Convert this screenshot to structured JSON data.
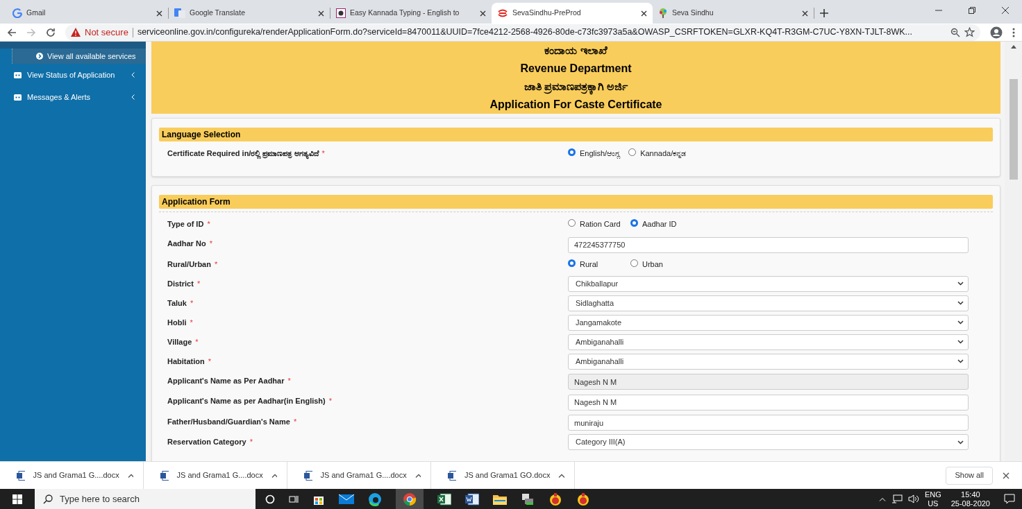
{
  "browser": {
    "tabs": [
      {
        "label": "Gmail",
        "selected": false,
        "kind": "gmail"
      },
      {
        "label": "Google Translate",
        "selected": false,
        "kind": "translate"
      },
      {
        "label": "Easy Kannada Typing - English to",
        "selected": false,
        "kind": "kannada"
      },
      {
        "label": "SevaSindhu-PreProd",
        "selected": true,
        "kind": "seva"
      },
      {
        "label": "Seva Sindhu",
        "selected": false,
        "kind": "tree"
      }
    ],
    "security": "Not secure",
    "url": "serviceonline.gov.in/configureka/renderApplicationForm.do?serviceId=8470011&UUID=7fce4212-2568-4926-80de-c73fc3973a5a&OWASP_CSRFTOKEN=GLXR-KQ4T-R3GM-C7UC-Y8XN-TJLT-8WK..."
  },
  "sidebar": {
    "items": [
      {
        "label": "View all available services",
        "kind": "sub",
        "selected": true
      },
      {
        "label": "View Status of Application",
        "kind": "menu",
        "selected": false
      },
      {
        "label": "Messages & Alerts",
        "kind": "menu",
        "selected": false
      }
    ]
  },
  "header": {
    "lines": [
      "ಕಂದಾಯ ಇಲಾಖೆ",
      "Revenue Department",
      "ಜಾತಿ ಪ್ರಮಾಣಪತ್ರಕ್ಕಾಗಿ ಅರ್ಜಿ",
      "Application For Caste Certificate"
    ]
  },
  "sections": [
    {
      "title": "Language Selection",
      "fields": [
        {
          "label": "Certificate Required in/ರಲ್ಲಿ ಪ್ರಮಾಣಪತ್ರ ಅಗತ್ಯವಿದೆ",
          "required": "*",
          "kind": "radio",
          "options": [
            {
              "label": "English/ಆಂಗ್ಲ",
              "selected": true
            },
            {
              "label": "Kannada/ಕನ್ನಡ",
              "selected": false
            }
          ]
        }
      ]
    },
    {
      "title": "Application Form",
      "fields": [
        {
          "label": "Type of ID",
          "required": "*",
          "kind": "radio",
          "options": [
            {
              "label": "Ration Card",
              "selected": false
            },
            {
              "label": "Aadhar ID",
              "selected": true
            }
          ]
        },
        {
          "label": "Aadhar No",
          "required": "*",
          "kind": "text",
          "value": "472245377750",
          "disabled": false
        },
        {
          "label": "Rural/Urban",
          "required": "*",
          "kind": "radio",
          "options": [
            {
              "label": "Rural",
              "selected": true
            },
            {
              "label": "Urban",
              "selected": false
            }
          ]
        },
        {
          "label": "District",
          "required": "*",
          "kind": "select",
          "value": "Chikballapur"
        },
        {
          "label": "Taluk",
          "required": "*",
          "kind": "select",
          "value": "Sidlaghatta"
        },
        {
          "label": "Hobli",
          "required": "*",
          "kind": "select",
          "value": "Jangamakote"
        },
        {
          "label": "Village",
          "required": "*",
          "kind": "select",
          "value": "Ambiganahalli"
        },
        {
          "label": "Habitation",
          "required": "*",
          "kind": "select",
          "value": "Ambiganahalli"
        },
        {
          "label": "Applicant's Name as Per Aadhar",
          "required": "*",
          "kind": "text",
          "value": "Nagesh N M",
          "disabled": true
        },
        {
          "label": "Applicant's Name as per Aadhar(in English)",
          "required": "*",
          "kind": "text",
          "value": "Nagesh N M",
          "disabled": false
        },
        {
          "label": "Father/Husband/Guardian's Name",
          "required": "*",
          "kind": "text",
          "value": "muniraju",
          "disabled": false
        },
        {
          "label": "Reservation Category",
          "required": "*",
          "kind": "select",
          "value": "Category III(A)"
        }
      ]
    }
  ],
  "downloads": {
    "items": [
      "JS and Grama1 G....docx",
      "JS and Grama1 G....docx",
      "JS and Grama1 G....docx",
      "JS and Grama1 GO.docx"
    ],
    "show_all": "Show all"
  },
  "taskbar": {
    "search_placeholder": "Type here to search",
    "language": "ENG",
    "region": "US",
    "time": "15:40",
    "date": "25-08-2020"
  }
}
